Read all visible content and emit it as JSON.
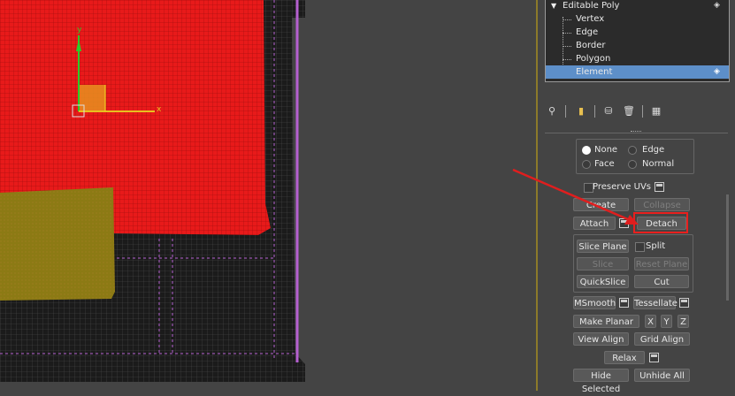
{
  "modifier_stack": {
    "root_label": "Editable Poly",
    "sub_objects": [
      "Vertex",
      "Edge",
      "Border",
      "Polygon",
      "Element"
    ],
    "selected": "Element"
  },
  "viewport": {
    "axis_y": "y",
    "axis_x": "x"
  },
  "selection_mode": {
    "none": "None",
    "edge": "Edge",
    "face": "Face",
    "normal": "Normal",
    "selected": "None"
  },
  "geometry": {
    "preserve_uvs": "Preserve UVs",
    "create": "Create",
    "collapse": "Collapse",
    "attach": "Attach",
    "detach": "Detach",
    "slice_plane": "Slice Plane",
    "split": "Split",
    "slice": "Slice",
    "reset_plane": "Reset Plane",
    "quickslice": "QuickSlice",
    "cut": "Cut",
    "msmooth": "MSmooth",
    "tessellate": "Tessellate",
    "make_planar": "Make Planar",
    "x": "X",
    "y": "Y",
    "z": "Z",
    "view_align": "View Align",
    "grid_align": "Grid Align",
    "relax": "Relax",
    "hide_selected": "Hide Selected",
    "unhide_all": "Unhide All"
  },
  "colors": {
    "selected_element": "#e81a1a",
    "second_object": "#8c7a14",
    "highlight_box": "#e8201e",
    "annotation_arrow": "#e01e1e"
  }
}
